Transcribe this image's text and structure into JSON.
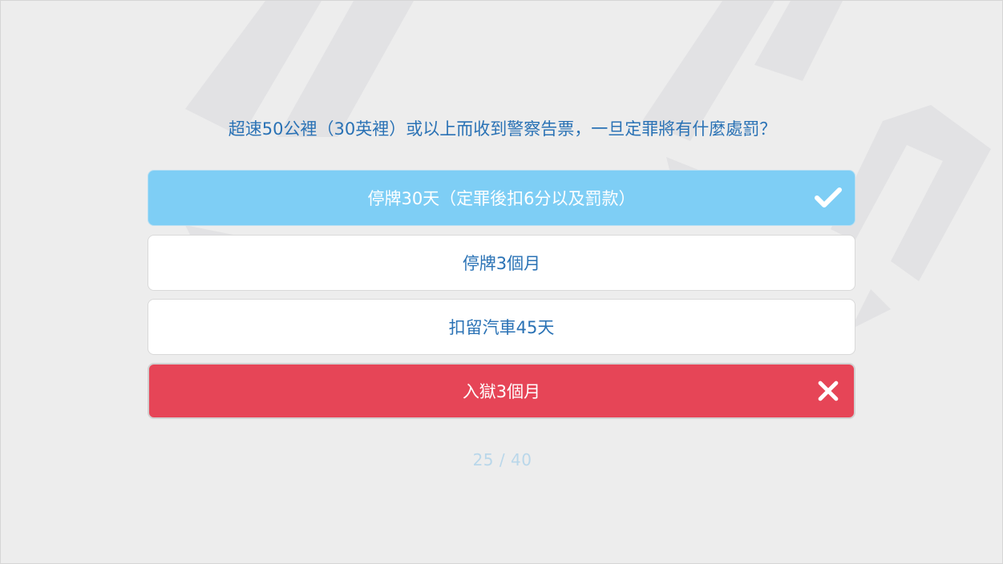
{
  "quiz": {
    "question": "超速50公裡（30英裡）或以上而收到警察告票，一旦定罪將有什麼處罰？",
    "options": [
      {
        "label": "停牌30天（定罪後扣6分以及罰款）",
        "state": "correct",
        "icon": "check-icon"
      },
      {
        "label": "停牌3個月",
        "state": "neutral"
      },
      {
        "label": "扣留汽車45天",
        "state": "neutral"
      },
      {
        "label": "入獄3個月",
        "state": "wrong",
        "icon": "cross-icon"
      }
    ],
    "progress": "25 / 40",
    "current": 25,
    "total": 40
  },
  "colors": {
    "background": "#ededed",
    "question_text": "#2a72b5",
    "correct": "#7ecef5",
    "wrong": "#e64557",
    "counter": "#b9d7ea"
  }
}
